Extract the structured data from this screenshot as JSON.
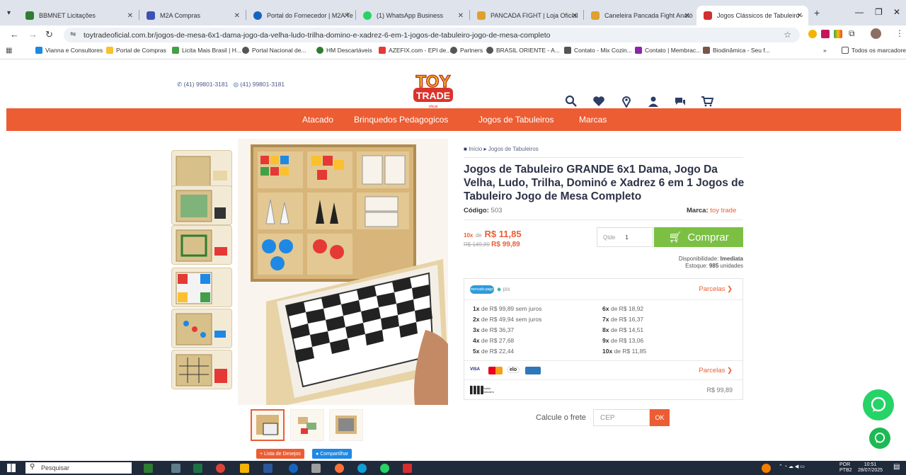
{
  "browser": {
    "tabs": [
      {
        "title": "BBMNET Licitações",
        "color": "#2e7d32"
      },
      {
        "title": "M2A Compras",
        "color": "#3f51b5"
      },
      {
        "title": "Portal do Fornecedor | M2A Te",
        "color": "#1565c0"
      },
      {
        "title": "(1) WhatsApp Business",
        "color": "#25d366"
      },
      {
        "title": "PANCADA FIGHT | Loja Oficial",
        "color": "#e0a030"
      },
      {
        "title": "Caneleira Pancada Fight Anató",
        "color": "#e0a030"
      },
      {
        "title": "Jogos Clássicos de Tabuleiro - ",
        "color": "#d32f2f"
      }
    ],
    "new_tab": "+",
    "url": "toytradeoficial.com.br/jogos-de-mesa-6x1-dama-jogo-da-velha-ludo-trilha-domino-e-xadrez-6-em-1-jogos-de-tabuleiro-jogo-de-mesa-completo",
    "bookmarks": [
      {
        "label": "Vianna e Consultores",
        "color": "#1e88e5"
      },
      {
        "label": "Portal de Compras",
        "color": "#fbc02d"
      },
      {
        "label": "Licita Mais Brasil | H...",
        "color": "#43a047"
      },
      {
        "label": "Portal Nacional de...",
        "color": "#555555"
      },
      {
        "label": "HM Descartáveis",
        "color": "#2e7d32"
      },
      {
        "label": "AZEFIX.com - EPI de...",
        "color": "#e53935"
      },
      {
        "label": "Partners",
        "color": "#555555"
      },
      {
        "label": "BRASIL ORIENTE - A...",
        "color": "#555555"
      },
      {
        "label": "Contato - Mix Cozin...",
        "color": "#555555"
      },
      {
        "label": "Contato | Membrac...",
        "color": "#8e24aa"
      },
      {
        "label": "Biodinâmica - Seu f...",
        "color": "#795548"
      }
    ],
    "bookmarks_more": "»",
    "all_bookmarks": "Todos os marcadores"
  },
  "site": {
    "phone1": "(41) 99801-3181",
    "phone2": "(41) 99801-3181",
    "logo_line1": "TOY",
    "logo_line2": "TRADE",
    "logo_line3": "oficial",
    "nav": [
      "Atacado",
      "Brinquedos Pedagogicos",
      "Jogos de Tabuleiros",
      "Marcas"
    ],
    "accent": "#ec5d33",
    "buy_color": "#7bc043"
  },
  "product": {
    "breadcrumb_home": "Início",
    "breadcrumb_sep": "▸",
    "breadcrumb_cat": "Jogos de Tabuleiros",
    "title": "Jogos de Tabuleiro GRANDE 6x1 Dama, Jogo Da Velha, Ludo, Trilha, Dominó e Xadrez 6 em 1 Jogos de Tabuleiro Jogo de Mesa Completo",
    "code_label": "Código:",
    "code_value": "503",
    "brand_label": "Marca:",
    "brand_value": "toy trade",
    "installments_prefix": "10x",
    "installments_de": "de",
    "installment_price": "R$ 11,85",
    "old_price": "R$ 149,89",
    "price": "R$ 99,89",
    "qty_label": "Qtde",
    "qty_value": "1",
    "buy_label": "Comprar",
    "availability_label": "Disponibilidade:",
    "availability_value": "Imediata",
    "stock_label": "Estoque:",
    "stock_value": "985",
    "stock_unit": "unidades",
    "payment_logo_mp": "mercado pago",
    "payment_logo_pix": "pix",
    "parcelas_label": "Parcelas",
    "installments_left": [
      {
        "n": "1x",
        "text": "de R$ 99,89 sem juros"
      },
      {
        "n": "2x",
        "text": "de R$ 49,94 sem juros"
      },
      {
        "n": "3x",
        "text": "de R$ 36,37"
      },
      {
        "n": "4x",
        "text": "de R$ 27,68"
      },
      {
        "n": "5x",
        "text": "de R$ 22,44"
      }
    ],
    "installments_right": [
      {
        "n": "6x",
        "text": "de R$ 18,92"
      },
      {
        "n": "7x",
        "text": "de R$ 16,37"
      },
      {
        "n": "8x",
        "text": "de R$ 14,51"
      },
      {
        "n": "9x",
        "text": "de R$ 13,06"
      },
      {
        "n": "10x",
        "text": "de R$ 11,85"
      }
    ],
    "cards": [
      "VISA",
      "mastercard",
      "elo",
      "amex"
    ],
    "boleto_label": "Boleto Bancário",
    "boleto_price": "R$ 99,89",
    "shipping_label": "Calcule o frete",
    "cep_placeholder": "CEP",
    "ok_label": "OK",
    "wishlist_label": "+ Lista de Desejos",
    "share_label": "Compartilhar"
  },
  "taskbar": {
    "search_placeholder": "Pesquisar",
    "lang1": "POR",
    "lang2": "PTB2",
    "time": "10:51",
    "date": "28/07/2025"
  }
}
